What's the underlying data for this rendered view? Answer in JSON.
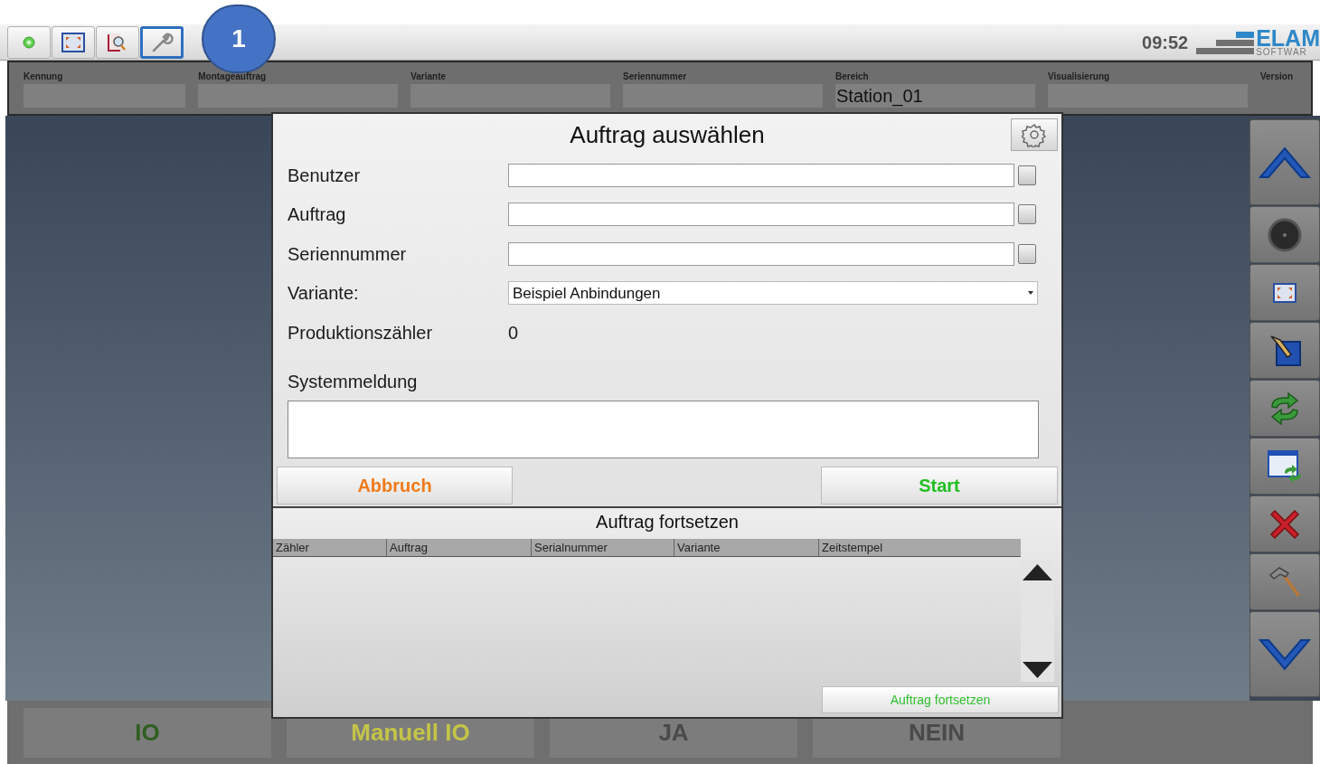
{
  "toolbar": {
    "buttons": [
      {
        "kind": "status",
        "selected": false
      },
      {
        "kind": "fullscreen",
        "selected": false
      },
      {
        "kind": "book",
        "selected": false
      },
      {
        "kind": "wrench",
        "selected": true
      }
    ],
    "callout": "1",
    "clock": "09:52",
    "logo": {
      "name": "ELAM",
      "subtitle": "SOFTWAR"
    }
  },
  "header": {
    "fields": [
      {
        "label": "Kennung"
      },
      {
        "label": "Montageauftrag"
      },
      {
        "label": "Variante"
      },
      {
        "label": "Seriennummer"
      },
      {
        "label": "Bereich",
        "value": "Station_01"
      },
      {
        "label": "Visualisierung"
      }
    ],
    "version_label": "Version"
  },
  "sidebar": {
    "buttons": [
      {
        "kind": "up"
      },
      {
        "kind": "dial"
      },
      {
        "kind": "fullscreen"
      },
      {
        "kind": "pen"
      },
      {
        "kind": "sync"
      },
      {
        "kind": "window-sync"
      },
      {
        "kind": "close"
      },
      {
        "kind": "hammer"
      },
      {
        "kind": "down"
      }
    ]
  },
  "bottom_bar": {
    "buttons": [
      {
        "label": "IO",
        "color": "#2f5f22"
      },
      {
        "label": "Manuell IO",
        "color": "#c4c448"
      },
      {
        "label": "JA",
        "color": "#4a4a4a"
      },
      {
        "label": "NEIN",
        "color": "#4a4a4a"
      }
    ]
  },
  "dialog": {
    "title": "Auftrag auswählen",
    "fields": [
      {
        "kind": "input",
        "label": "Benutzer"
      },
      {
        "kind": "input",
        "label": "Auftrag"
      },
      {
        "kind": "input",
        "label": "Seriennummer"
      },
      {
        "kind": "select",
        "label": "Variante:",
        "value": "Beispiel Anbindungen"
      },
      {
        "kind": "value",
        "label": "Produktionszähler",
        "value": "0"
      }
    ],
    "message_label": "Systemmeldung",
    "cancel": "Abbruch",
    "start": "Start",
    "resume": {
      "title": "Auftrag fortsetzen",
      "columns": [
        "Zähler",
        "Auftrag",
        "Serialnummer",
        "Variante",
        "Zeitstempel"
      ],
      "button": "Auftrag fortsetzen"
    }
  }
}
